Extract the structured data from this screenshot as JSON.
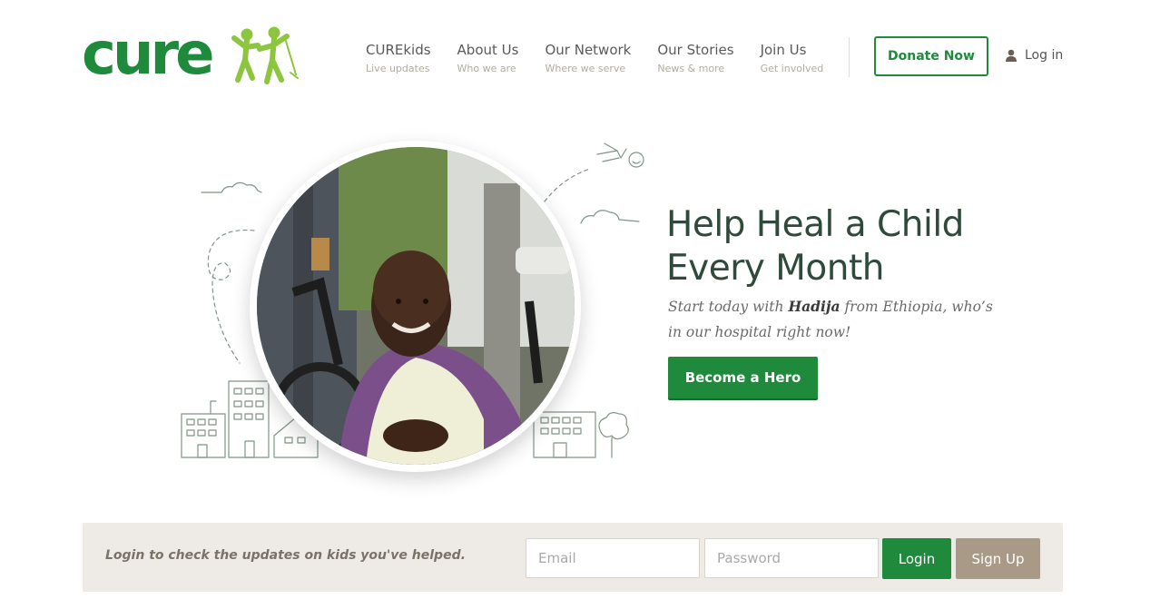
{
  "brand": {
    "logo_text": "cure",
    "primary_color": "#1f8a3c",
    "accent_color": "#8cc63f"
  },
  "nav": {
    "items": [
      {
        "label": "CUREkids",
        "sub": "Live updates"
      },
      {
        "label": "About Us",
        "sub": "Who we are"
      },
      {
        "label": "Our Network",
        "sub": "Where we serve"
      },
      {
        "label": "Our Stories",
        "sub": "News & more"
      },
      {
        "label": "Join Us",
        "sub": "Get involved"
      }
    ],
    "donate_label": "Donate Now",
    "login_label": "Log in",
    "user_icon": "user-icon"
  },
  "hero": {
    "title": "Help Heal a Child Every Month",
    "text_prefix": "Start today with ",
    "child_name": "Hadija",
    "text_suffix": " from Ethiopia, who’s in our hospital right now!",
    "button_label": "Become a Hero"
  },
  "login_bar": {
    "message": "Login to check the updates on kids you've helped.",
    "email_placeholder": "Email",
    "password_placeholder": "Password",
    "login_label": "Login",
    "signup_label": "Sign Up"
  }
}
